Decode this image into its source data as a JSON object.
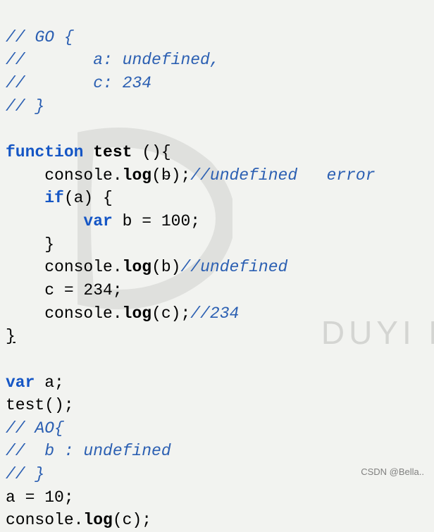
{
  "lines": {
    "l1": "// GO {",
    "l2_prefix": "//       a: ",
    "l2_val": "undefined,",
    "l3_prefix": "//       c: ",
    "l3_val": "234",
    "l4": "// }",
    "l5": "",
    "l6_kw1": "function",
    "l6_name": " test ",
    "l6_paren": "(){",
    "l7_call": "    console.",
    "l7_fn": "log",
    "l7_arg_open": "(",
    "l7_arg": "b",
    "l7_close": ");",
    "l7_cm": "//undefined   error",
    "l8_if": "    if",
    "l8_rest": "(a) {",
    "l9_pad": "        ",
    "l9_var": "var",
    "l9_rest": " b = 100;",
    "l10": "    }",
    "l11_call": "    console.",
    "l11_fn": "log",
    "l11_args": "(b)",
    "l11_cm": "//undefined",
    "l12": "    c = 234;",
    "l13_call": "    console.",
    "l13_fn": "log",
    "l13_args": "(c);",
    "l13_cm": "//234",
    "l14": "}",
    "l15": "",
    "l16_var": "var",
    "l16_rest": " a;",
    "l17": "test();",
    "l18": "// AO{",
    "l19": "//  b : undefined",
    "l20": "// }",
    "l21": "a = 10;",
    "l22_call": "console.",
    "l22_fn": "log",
    "l22_args": "(c);"
  },
  "watermark": "CSDN @Bella..",
  "bgtext": "DUYI EI"
}
